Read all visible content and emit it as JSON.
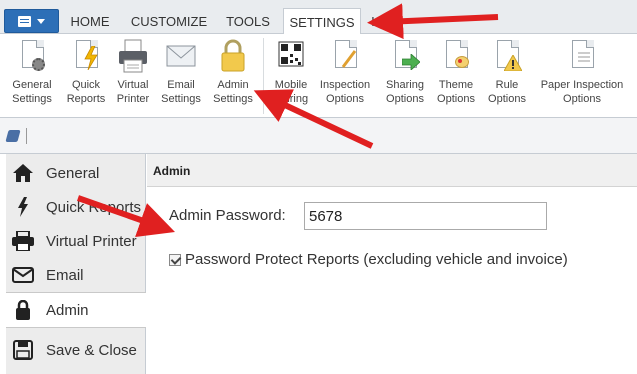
{
  "tabs": [
    {
      "label": "HOME",
      "active": false
    },
    {
      "label": "CUSTOMIZE",
      "active": false
    },
    {
      "label": "TOOLS",
      "active": false
    },
    {
      "label": "SETTINGS",
      "active": true
    },
    {
      "label": "H",
      "active": false
    }
  ],
  "ribbon": {
    "buttons": [
      {
        "label": "General\nSettings",
        "icon": "gear-document-icon"
      },
      {
        "label": "Quick\nReports",
        "icon": "lightning-document-icon"
      },
      {
        "label": "Virtual\nPrinter",
        "icon": "printer-icon"
      },
      {
        "label": "Email\nSettings",
        "icon": "envelope-icon"
      },
      {
        "label": "Admin\nSettings",
        "icon": "padlock-icon"
      },
      {
        "label": "Mobile\nPairing",
        "icon": "qr-code-icon"
      },
      {
        "label": "Inspection\nOptions",
        "icon": "pen-document-icon"
      },
      {
        "label": "Sharing\nOptions",
        "icon": "share-document-icon"
      },
      {
        "label": "Theme\nOptions",
        "icon": "palette-document-icon"
      },
      {
        "label": "Rule\nOptions",
        "icon": "warning-document-icon"
      },
      {
        "label": "Paper Inspection\nOptions",
        "icon": "paper-document-icon"
      }
    ]
  },
  "nav": {
    "items": [
      {
        "label": "General",
        "icon": "home-icon",
        "selected": false
      },
      {
        "label": "Quick Reports",
        "icon": "lightning-icon",
        "selected": false
      },
      {
        "label": "Virtual Printer",
        "icon": "printer-icon",
        "selected": false
      },
      {
        "label": "Email",
        "icon": "envelope-icon",
        "selected": false
      },
      {
        "label": "Admin",
        "icon": "padlock-icon",
        "selected": true
      },
      {
        "label": "Save & Close",
        "icon": "save-icon",
        "selected": false
      }
    ]
  },
  "content": {
    "title": "Admin",
    "password_label": "Admin Password:",
    "password_value": "5678",
    "protect_label": "Password Protect Reports (excluding vehicle and invoice)",
    "protect_checked": true
  },
  "colors": {
    "accent": "#2d6fb7",
    "annotation_arrow": "#e02020"
  }
}
